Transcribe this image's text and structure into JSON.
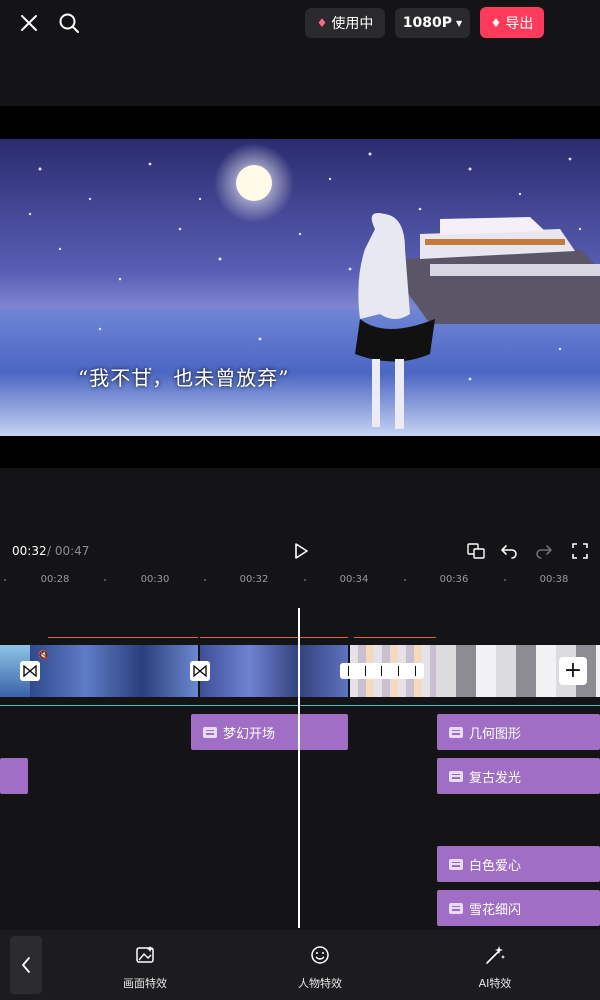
{
  "topbar": {
    "close_icon": "close-icon",
    "search_icon": "search-icon",
    "vip_label": "使用中",
    "resolution_label": "1080P",
    "export_label": "导出"
  },
  "preview": {
    "caption": "“我不甘，也未曾放弃”"
  },
  "controls": {
    "current_time": "00:32",
    "total_time": " / 00:47"
  },
  "ruler": {
    "labels": [
      "00:28",
      "00:30",
      "00:32",
      "00:34",
      "00:36",
      "00:38"
    ]
  },
  "effects": [
    {
      "label": "梦幻开场"
    },
    {
      "label": "几何图形"
    },
    {
      "label": "复古发光"
    },
    {
      "label": "白色爱心"
    },
    {
      "label": "雪花细闪"
    }
  ],
  "bottombar": {
    "tools": [
      {
        "label": "画面特效",
        "icon": "image-effect-icon"
      },
      {
        "label": "人物特效",
        "icon": "face-effect-icon"
      },
      {
        "label": "AI特效",
        "icon": "ai-magic-icon"
      }
    ]
  },
  "colors": {
    "accent": "#ff3b5c",
    "effect": "#a06fc5",
    "background": "#141416"
  }
}
